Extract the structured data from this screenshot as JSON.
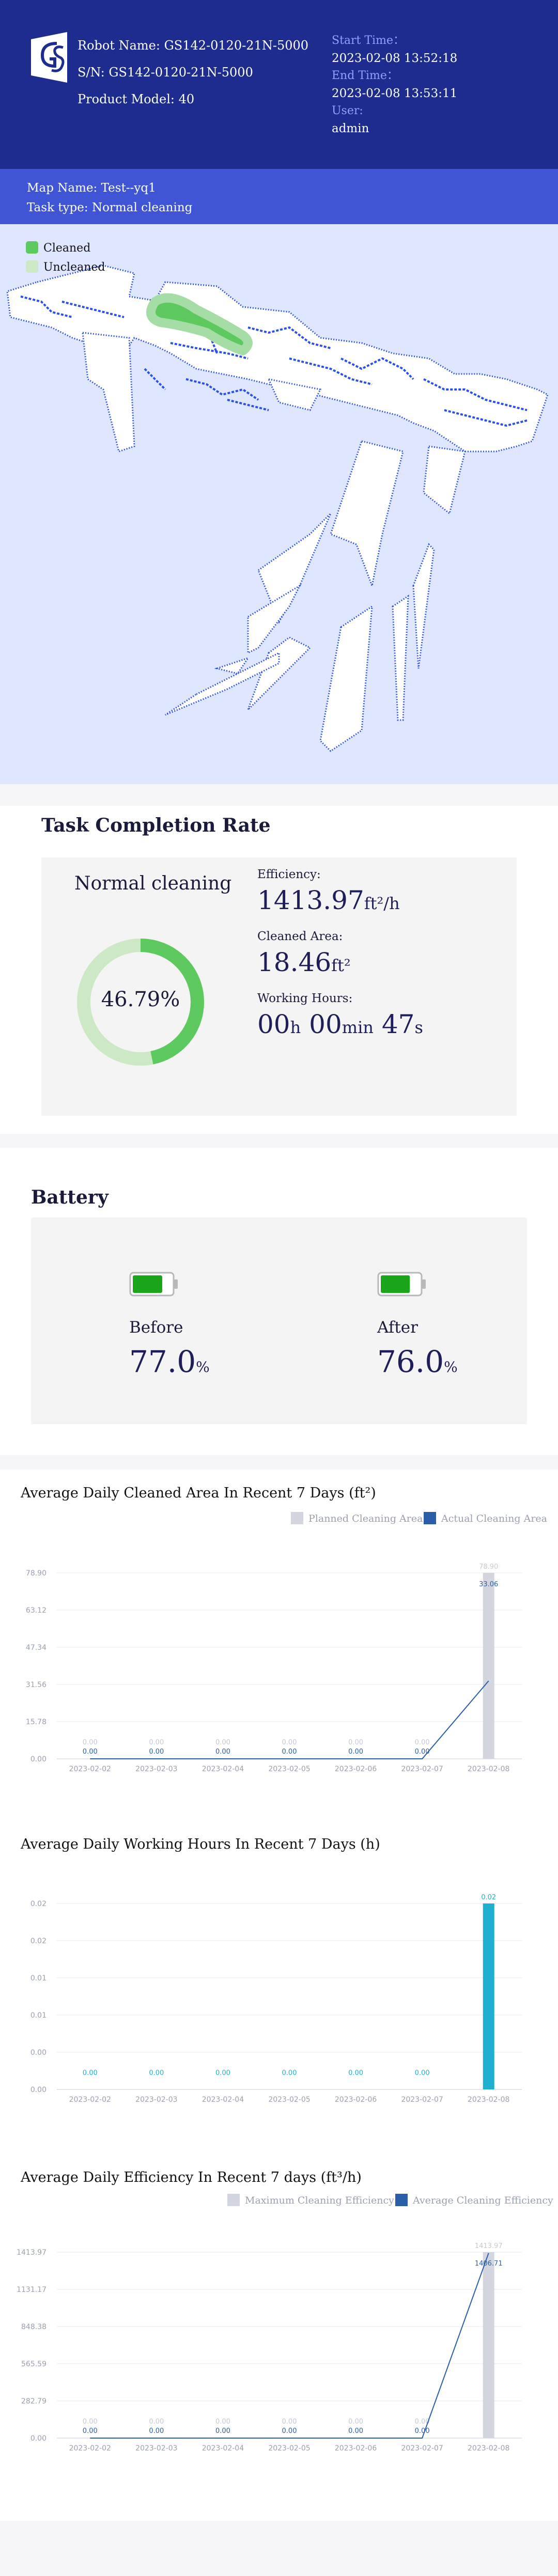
{
  "header": {
    "robot_name": "Robot Name: GS142-0120-21N-5000",
    "sn": "S/N: GS142-0120-21N-5000",
    "product_model": "Product Model: 40",
    "start_time_label": "Start Time：",
    "start_time": "2023-02-08 13:52:18",
    "end_time_label": "End Time：",
    "end_time": "2023-02-08 13:53:11",
    "user_label": "User:",
    "user": "admin"
  },
  "map_info": {
    "map_name": "Map Name: Test--yq1",
    "task_type": "Task type: Normal cleaning",
    "legend": {
      "cleaned": "Cleaned",
      "uncleaned": "Uncleaned"
    },
    "colors": {
      "cleaned": "#5ec95e",
      "uncleaned": "#cde8c4",
      "wall": "#2a50e8",
      "floor": "#ffffff",
      "bg": "#dfe6ff"
    }
  },
  "task": {
    "title": "Task Completion Rate",
    "mode": "Normal cleaning",
    "completion": 0.4679,
    "completion_text": "46.79%",
    "efficiency_label": "Efficiency:",
    "efficiency_value": "1413.97",
    "efficiency_unit": "ft²/h",
    "area_label": "Cleaned Area:",
    "area_value": "18.46",
    "area_unit": "ft²",
    "hours_label": "Working Hours:",
    "hours_h": "00",
    "hours_h_unit": "h",
    "hours_min": "00",
    "hours_min_unit": "min",
    "hours_s": "47",
    "hours_s_unit": "s",
    "colors": {
      "ring_fill": "#5ec95e",
      "ring_track": "#cde8c4"
    }
  },
  "battery": {
    "title": "Battery",
    "before_label": "Before",
    "before_value": "77.0",
    "after_label": "After",
    "after_value": "76.0",
    "unit": "%",
    "before_level": 0.77,
    "after_level": 0.76,
    "colors": {
      "fill": "#1aa51a"
    }
  },
  "chart_data": [
    {
      "type": "bar",
      "title": "Average Daily Cleaned Area In Recent 7 Days (ft²)",
      "categories": [
        "2023-02-02",
        "2023-02-03",
        "2023-02-04",
        "2023-02-05",
        "2023-02-06",
        "2023-02-07",
        "2023-02-08"
      ],
      "yticks": [
        "0.00",
        "15.78",
        "31.56",
        "47.34",
        "63.12",
        "78.90"
      ],
      "ylim": [
        0,
        78.9
      ],
      "series": [
        {
          "name": "Planned Cleaning Area",
          "kind": "bar",
          "color": "#d3d6de",
          "values": [
            0,
            0,
            0,
            0,
            0,
            0,
            78.9
          ],
          "labels": [
            "0.00",
            "0.00",
            "0.00",
            "0.00",
            "0.00",
            "0.00",
            "78.90"
          ]
        },
        {
          "name": "Actual Cleaning Area",
          "kind": "line",
          "color": "#2a5ea8",
          "values": [
            0,
            0,
            0,
            0,
            0,
            0,
            33.06
          ],
          "labels": [
            "0.00",
            "0.00",
            "0.00",
            "0.00",
            "0.00",
            "0.00",
            "33.06"
          ]
        }
      ],
      "legend": "top-right"
    },
    {
      "type": "bar",
      "title": "Average Daily Working Hours In Recent 7 Days (h)",
      "categories": [
        "2023-02-02",
        "2023-02-03",
        "2023-02-04",
        "2023-02-05",
        "2023-02-06",
        "2023-02-07",
        "2023-02-08"
      ],
      "yticks": [
        "0.00",
        "0.00",
        "0.01",
        "0.01",
        "0.02",
        "0.02"
      ],
      "ylim": [
        0,
        0.02
      ],
      "series": [
        {
          "name": "",
          "kind": "bar",
          "color": "#1fb0d0",
          "values": [
            0,
            0,
            0,
            0,
            0,
            0,
            0.02
          ],
          "labels": [
            "0.00",
            "0.00",
            "0.00",
            "0.00",
            "0.00",
            "0.00",
            "0.02"
          ]
        }
      ],
      "legend": "none"
    },
    {
      "type": "bar",
      "title": "Average Daily Efficiency In Recent 7 days (ft³/h)",
      "categories": [
        "2023-02-02",
        "2023-02-03",
        "2023-02-04",
        "2023-02-05",
        "2023-02-06",
        "2023-02-07",
        "2023-02-08"
      ],
      "yticks": [
        "0.00",
        "282.79",
        "565.59",
        "848.38",
        "1131.17",
        "1413.97"
      ],
      "ylim": [
        0,
        1413.97
      ],
      "series": [
        {
          "name": "Maximum Cleaning Efficiency",
          "kind": "bar",
          "color": "#d3d6de",
          "values": [
            0,
            0,
            0,
            0,
            0,
            0,
            1413.97
          ],
          "labels": [
            "0.00",
            "0.00",
            "0.00",
            "0.00",
            "0.00",
            "0.00",
            "1413.97"
          ]
        },
        {
          "name": "Average Cleaning Efficiency",
          "kind": "line",
          "color": "#2a5ea8",
          "values": [
            0,
            0,
            0,
            0,
            0,
            0,
            1406.71
          ],
          "labels": [
            "0.00",
            "0.00",
            "0.00",
            "0.00",
            "0.00",
            "0.00",
            "1406.71"
          ]
        }
      ],
      "legend": "top-right"
    }
  ]
}
